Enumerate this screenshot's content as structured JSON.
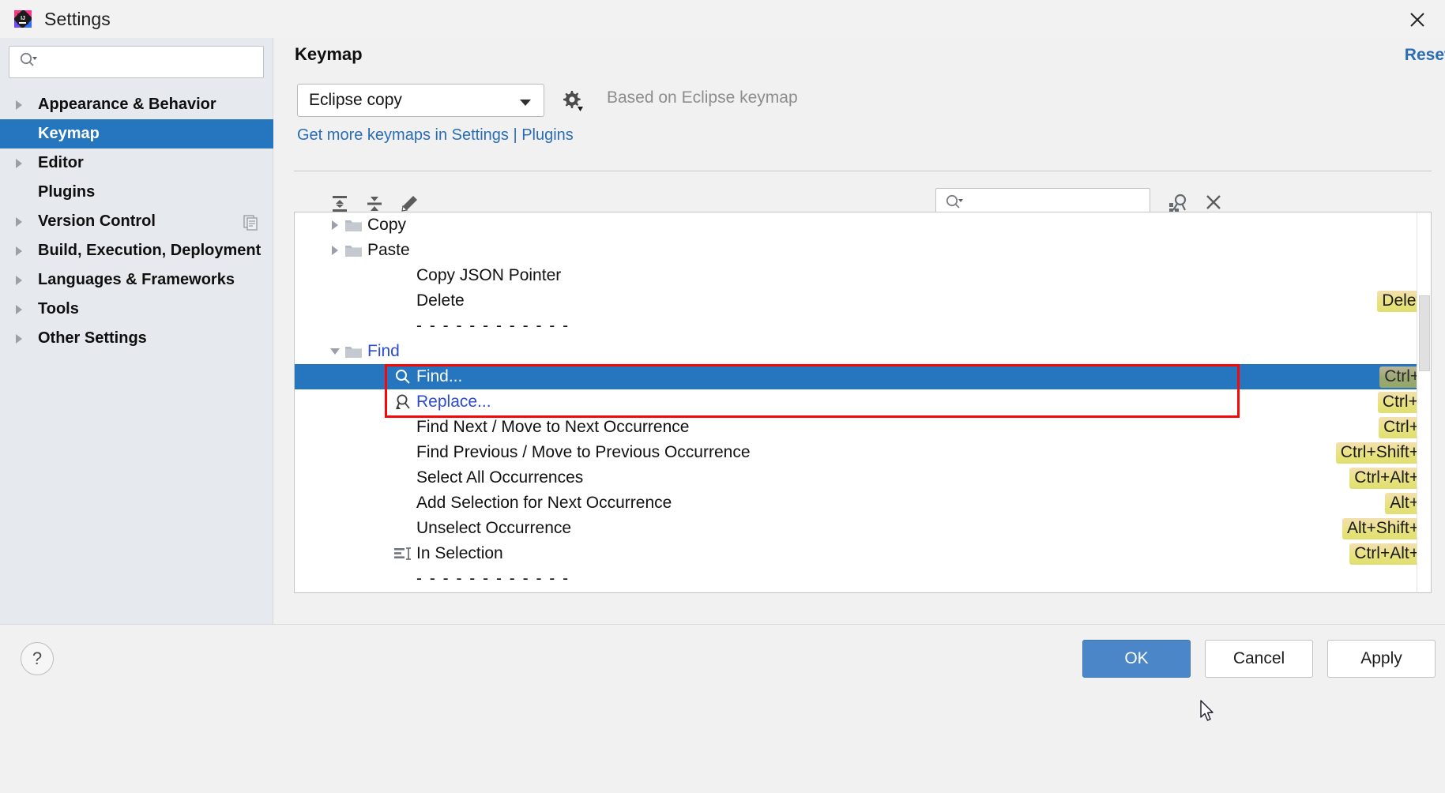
{
  "window": {
    "title": "Settings",
    "app_icon": "intellij-idea-icon",
    "close_icon": "close-icon"
  },
  "sidebar": {
    "search": {
      "placeholder": "",
      "value": "",
      "icon": "search-dropdown-icon"
    },
    "items": [
      {
        "label": "Appearance & Behavior",
        "expandable": true,
        "selected": false,
        "badge": null
      },
      {
        "label": "Keymap",
        "expandable": false,
        "selected": true,
        "badge": null
      },
      {
        "label": "Editor",
        "expandable": true,
        "selected": false,
        "badge": null
      },
      {
        "label": "Plugins",
        "expandable": false,
        "selected": false,
        "badge": null
      },
      {
        "label": "Version Control",
        "expandable": true,
        "selected": false,
        "badge": "copy-badge-icon"
      },
      {
        "label": "Build, Execution, Deployment",
        "expandable": true,
        "selected": false,
        "badge": null
      },
      {
        "label": "Languages & Frameworks",
        "expandable": true,
        "selected": false,
        "badge": null
      },
      {
        "label": "Tools",
        "expandable": true,
        "selected": false,
        "badge": null
      },
      {
        "label": "Other Settings",
        "expandable": true,
        "selected": false,
        "badge": null
      }
    ]
  },
  "main": {
    "page_title": "Keymap",
    "reset_label": "Reset",
    "keymap_select": {
      "value": "Eclipse copy",
      "arrow_icon": "chevron-down-icon"
    },
    "gear_icon": "gear-dropdown-icon",
    "based_on": "Based on Eclipse keymap",
    "plugins_link": "Get more keymaps in Settings | Plugins",
    "toolbar": {
      "expand_all_icon": "expand-all-icon",
      "collapse_all_icon": "collapse-all-icon",
      "edit_icon": "pencil-edit-icon",
      "search": {
        "placeholder": "",
        "value": "",
        "icon": "search-dropdown-icon"
      },
      "find_shortcut_icon": "find-by-shortcut-icon",
      "close_icon": "close-icon"
    }
  },
  "tree": {
    "rows": [
      {
        "indent": 1,
        "twisty": "collapsed",
        "icon": "folder-icon",
        "label": "Copy",
        "link": false,
        "shortcut": "",
        "selected": false
      },
      {
        "indent": 1,
        "twisty": "collapsed",
        "icon": "folder-icon",
        "label": "Paste",
        "link": false,
        "shortcut": "",
        "selected": false
      },
      {
        "indent": 2,
        "twisty": "none",
        "icon": "none",
        "label": "Copy JSON Pointer",
        "link": false,
        "shortcut": "",
        "selected": false
      },
      {
        "indent": 2,
        "twisty": "none",
        "icon": "none",
        "label": "Delete",
        "link": false,
        "shortcut": "Delete",
        "selected": false
      },
      {
        "indent": 2,
        "twisty": "none",
        "icon": "none",
        "label": "- - - - - - - - - - - -",
        "link": false,
        "shortcut": "",
        "selected": false,
        "separator": true
      },
      {
        "indent": 1,
        "twisty": "expanded",
        "icon": "folder-icon",
        "label": "Find",
        "link": true,
        "shortcut": "",
        "selected": false
      },
      {
        "indent": 2,
        "twisty": "none",
        "icon": "find-icon",
        "label": "Find...",
        "link": false,
        "shortcut": "Ctrl+F",
        "selected": true
      },
      {
        "indent": 2,
        "twisty": "none",
        "icon": "replace-icon",
        "label": "Replace...",
        "link": true,
        "shortcut": "Ctrl+R",
        "selected": false
      },
      {
        "indent": 2,
        "twisty": "none",
        "icon": "none",
        "label": "Find Next / Move to Next Occurrence",
        "link": false,
        "shortcut": "Ctrl+K",
        "selected": false
      },
      {
        "indent": 2,
        "twisty": "none",
        "icon": "none",
        "label": "Find Previous / Move to Previous Occurrence",
        "link": false,
        "shortcut": "Ctrl+Shift+K",
        "selected": false
      },
      {
        "indent": 2,
        "twisty": "none",
        "icon": "none",
        "label": "Select All Occurrences",
        "link": false,
        "shortcut": "Ctrl+Alt+Y",
        "selected": false
      },
      {
        "indent": 2,
        "twisty": "none",
        "icon": "none",
        "label": "Add Selection for Next Occurrence",
        "link": false,
        "shortcut": "Alt+Y",
        "selected": false
      },
      {
        "indent": 2,
        "twisty": "none",
        "icon": "none",
        "label": "Unselect Occurrence",
        "link": false,
        "shortcut": "Alt+Shift+Y",
        "selected": false
      },
      {
        "indent": 2,
        "twisty": "none",
        "icon": "in-selection-icon",
        "label": "In Selection",
        "link": false,
        "shortcut": "Ctrl+Alt+E",
        "selected": false
      },
      {
        "indent": 2,
        "twisty": "none",
        "icon": "none",
        "label": "- - - - - - - - - - - -",
        "link": false,
        "shortcut": "",
        "selected": false,
        "separator": true
      }
    ]
  },
  "footer": {
    "help_label": "?",
    "ok_label": "OK",
    "cancel_label": "Cancel",
    "apply_label": "Apply"
  },
  "colors": {
    "selection_blue": "#2675bf",
    "link_blue": "#2a6db5",
    "tree_link_blue": "#2b4ad6",
    "shortcut_yellow": "#e9e27e",
    "annotation_red": "#fb0606",
    "sidebar_bg": "#e6eaee",
    "panel_bg": "#f1f1f1"
  }
}
